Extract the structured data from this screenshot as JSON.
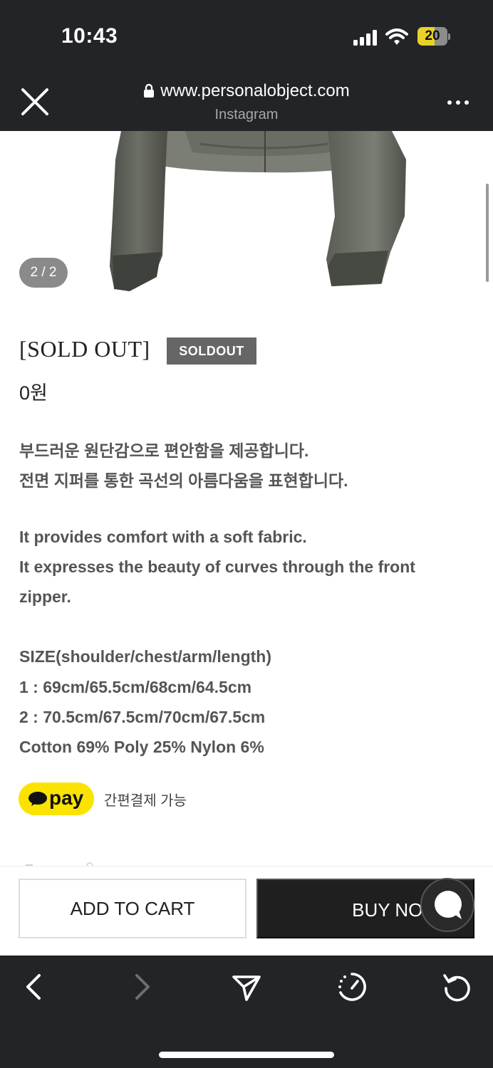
{
  "status_bar": {
    "time": "10:43",
    "battery": "20"
  },
  "browser": {
    "url": "www.personalobject.com",
    "subtitle": "Instagram"
  },
  "gallery": {
    "counter": "2 / 2"
  },
  "product": {
    "title": "[SOLD OUT]",
    "badge": "SOLDOUT",
    "price": "0원",
    "description": [
      "부드러운 원단감으로 편안함을 제공합니다.",
      "전면 지퍼를 통한 곡선의 아름다움을 표현합니다.",
      "It provides comfort with a soft fabric.",
      "It expresses the beauty of curves through the front",
      "zipper.",
      "SIZE(shoulder/chest/arm/length)",
      "1 : 69cm/65.5cm/68cm/64.5cm",
      "2 : 70.5cm/67.5cm/70cm/67.5cm",
      "Cotton 69% Poly 25% Nylon 6%"
    ]
  },
  "payment": {
    "logo_text": "pay",
    "note": "간편결제 가능"
  },
  "actions": {
    "add_to_cart": "ADD TO CART",
    "buy_now": "BUY NOW"
  },
  "colors": {
    "kakao_yellow": "#fbe300",
    "dark_bar": "#232427",
    "badge_gray": "#666666"
  },
  "icons": [
    "close-icon",
    "lock-icon",
    "more-icon",
    "chat-icon",
    "back-icon",
    "forward-icon",
    "share-icon",
    "speed-icon",
    "reload-icon"
  ]
}
